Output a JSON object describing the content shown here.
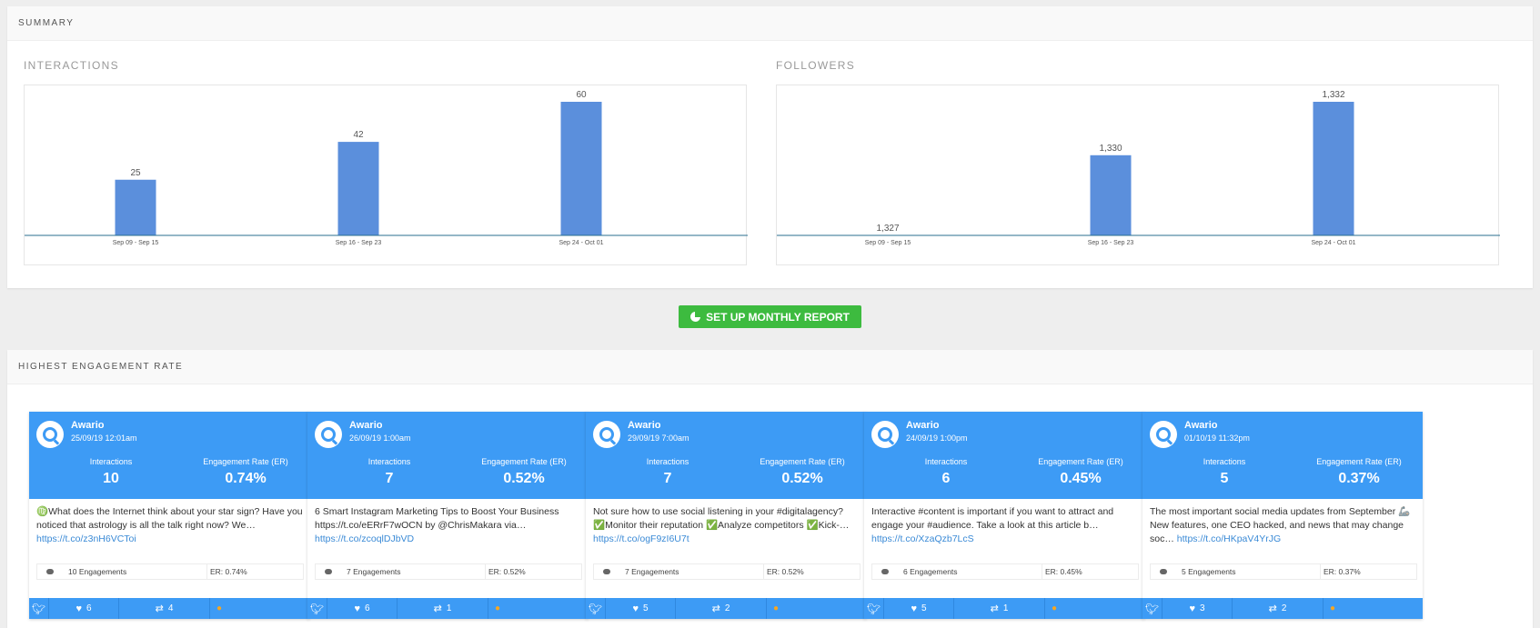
{
  "summary": {
    "header": "SUMMARY",
    "charts": [
      {
        "title": "INTERACTIONS"
      },
      {
        "title": "FOLLOWERS"
      }
    ]
  },
  "chart_data": [
    {
      "type": "bar",
      "title": "INTERACTIONS",
      "categories": [
        "Sep 09 - Sep 15",
        "Sep 16 - Sep 23",
        "Sep 24 - Oct 01"
      ],
      "values": [
        25,
        42,
        60
      ],
      "labels": [
        "25",
        "42",
        "60"
      ],
      "ylim": [
        0,
        60
      ],
      "grid": false,
      "color": "#5b8fdc"
    },
    {
      "type": "bar",
      "title": "FOLLOWERS",
      "categories": [
        "Sep 09 - Sep 15",
        "Sep 16 - Sep 23",
        "Sep 24 - Oct 01"
      ],
      "values": [
        1327,
        1330,
        1332
      ],
      "labels": [
        "1,327",
        "1,330",
        "1,332"
      ],
      "ylim": [
        1327,
        1332
      ],
      "grid": false,
      "color": "#5b8fdc"
    }
  ],
  "report_button": {
    "label": "SET UP MONTHLY REPORT",
    "color": "#3dbb3f"
  },
  "engagement": {
    "header": "HIGHEST ENGAGEMENT RATE",
    "interactions_label": "Interactions",
    "er_label": "Engagement Rate (ER)",
    "cards": [
      {
        "author": "Awario",
        "date": "25/09/19 12:01am",
        "interactions": "10",
        "er": "0.74%",
        "text": "♍What does the Internet think about your star sign? Have you noticed that astrology is all the talk right now? We…",
        "link": "https://t.co/z3nH6VCToi",
        "engagements": "10 Engagements",
        "er_meta": "ER: 0.74%",
        "likes": "6",
        "retweets": "4"
      },
      {
        "author": "Awario",
        "date": "26/09/19 1:00am",
        "interactions": "7",
        "er": "0.52%",
        "text": "6 Smart Instagram Marketing Tips to Boost Your Business https://t.co/eERrF7wOCN by @ChrisMakara via…",
        "link": "https://t.co/zcoqlDJbVD",
        "engagements": "7 Engagements",
        "er_meta": "ER: 0.52%",
        "likes": "6",
        "retweets": "1"
      },
      {
        "author": "Awario",
        "date": "29/09/19 7:00am",
        "interactions": "7",
        "er": "0.52%",
        "text": "Not sure how to use social listening in your #digitalagency? ✅Monitor their reputation ✅Analyze competitors ✅Kick-…",
        "link": "https://t.co/ogF9zI6U7t",
        "engagements": "7 Engagements",
        "er_meta": "ER: 0.52%",
        "likes": "5",
        "retweets": "2"
      },
      {
        "author": "Awario",
        "date": "24/09/19 1:00pm",
        "interactions": "6",
        "er": "0.45%",
        "text": "Interactive #content is important if you want to attract and engage your #audience. Take a look at this article b…",
        "link": "https://t.co/XzaQzb7LcS",
        "engagements": "6 Engagements",
        "er_meta": "ER: 0.45%",
        "likes": "5",
        "retweets": "1"
      },
      {
        "author": "Awario",
        "date": "01/10/19 11:32pm",
        "interactions": "5",
        "er": "0.37%",
        "text": "The most important social media updates from September 🦾 New features, one CEO hacked, and news that may change soc…",
        "link": "https://t.co/HKpaV4YrJG",
        "engagements": "5 Engagements",
        "er_meta": "ER: 0.37%",
        "likes": "3",
        "retweets": "2"
      }
    ]
  }
}
